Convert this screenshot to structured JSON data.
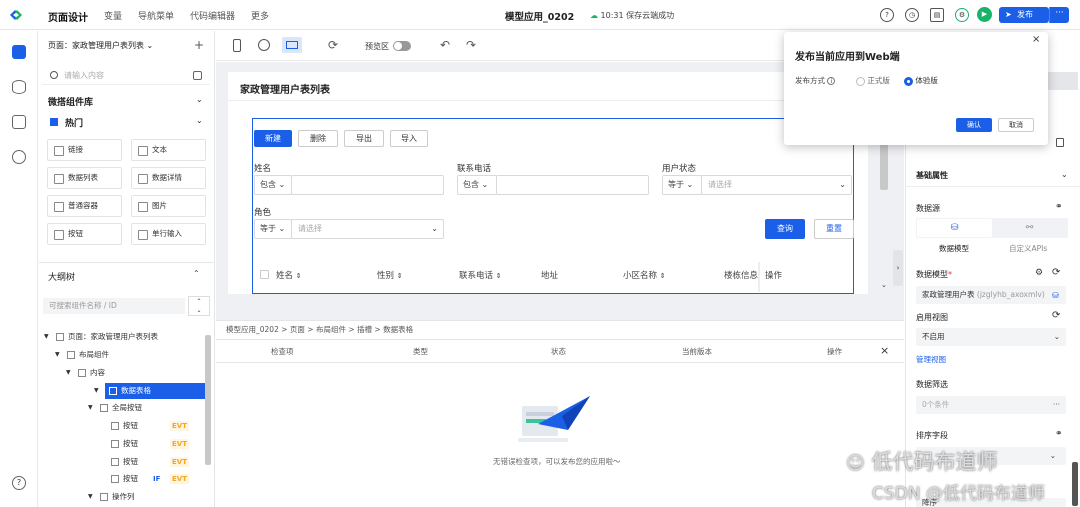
{
  "topbar": {
    "nav": [
      "页面设计",
      "变量",
      "导航菜单",
      "代码编辑器",
      "更多"
    ],
    "app_name": "模型应用_0202",
    "save_status": "10:31 保存云端成功",
    "publish_label": "发布",
    "more_label": "···"
  },
  "left_panel": {
    "page_selector": "页面：家政管理用户表列表",
    "plus": "+",
    "search_placeholder": "请输入内容",
    "lib_title": "微搭组件库",
    "hot_title": "热门",
    "components": [
      "链接",
      "文本",
      "数据列表",
      "数据详情",
      "普通容器",
      "图片",
      "按钮",
      "单行输入"
    ],
    "outline_title": "大纲树",
    "outline_search_placeholder": "可搜索组件名称 / ID",
    "tree": [
      {
        "label": "页面：家政管理用户表列表",
        "indent": 0
      },
      {
        "label": "布局组件",
        "indent": 1
      },
      {
        "label": "内容",
        "indent": 2
      },
      {
        "label": "数据表格",
        "indent": 3,
        "selected": true
      },
      {
        "label": "全局按钮",
        "indent": 4
      },
      {
        "label": "按钮",
        "indent": 5,
        "evt": "EVT"
      },
      {
        "label": "按钮",
        "indent": 5,
        "evt": "EVT"
      },
      {
        "label": "按钮",
        "indent": 5,
        "evt": "EVT"
      },
      {
        "label": "按钮",
        "indent": 5,
        "evt": "EVT",
        "if": "IF"
      },
      {
        "label": "操作列",
        "indent": 4
      }
    ]
  },
  "canvas_toolbar": {
    "preview_label": "预览区"
  },
  "page": {
    "title": "家政管理用户表列表",
    "buttons": [
      "新建",
      "删除",
      "导出",
      "导入"
    ],
    "filters": [
      {
        "label": "姓名",
        "op": "包含",
        "value": ""
      },
      {
        "label": "联系电话",
        "op": "包含",
        "value": ""
      },
      {
        "label": "用户状态",
        "op": "等于",
        "placeholder": "请选择"
      },
      {
        "label": "角色",
        "op": "等于",
        "placeholder": "请选择"
      }
    ],
    "query_label": "查询",
    "reset_label": "重置",
    "columns": [
      "姓名",
      "性别",
      "联系电话",
      "地址",
      "小区名称",
      "楼栋信息",
      "操作"
    ]
  },
  "bottom": {
    "breadcrumb": [
      "模型应用_0202",
      "页面",
      "布局组件",
      "插槽",
      "数据表格"
    ],
    "headers": [
      "检查项",
      "类型",
      "状态",
      "当前版本",
      "操作"
    ],
    "close": "×",
    "empty_text": "无错误检查项，可以发布您的应用啦～"
  },
  "right_panel": {
    "section_basic": "基础属性",
    "datasource_label": "数据源",
    "tab_model": "数据模型",
    "tab_api": "自定义APIs",
    "model_label": "数据模型",
    "required_mark": "*",
    "model_value": "家政管理用户表",
    "model_id": "(jzglyhb_axoxmlv)",
    "view_label": "启用视图",
    "view_value": "不启用",
    "manage_view": "管理视图",
    "filter_label": "数据筛选",
    "filter_value": "0个条件",
    "sort_label": "排序字段",
    "sort_value": "降序"
  },
  "dialog": {
    "title": "发布当前应用到Web端",
    "close": "×",
    "mode_label": "发布方式",
    "options": [
      "正式版",
      "体验版"
    ],
    "selected": "体验版",
    "confirm": "确认",
    "cancel": "取消"
  },
  "watermark": {
    "line1": "低代码布道师",
    "line2": "CSDN @低代码布道师"
  },
  "colors": {
    "primary": "#1b5fe8",
    "green": "#18b368",
    "evt": "#f5a623"
  }
}
